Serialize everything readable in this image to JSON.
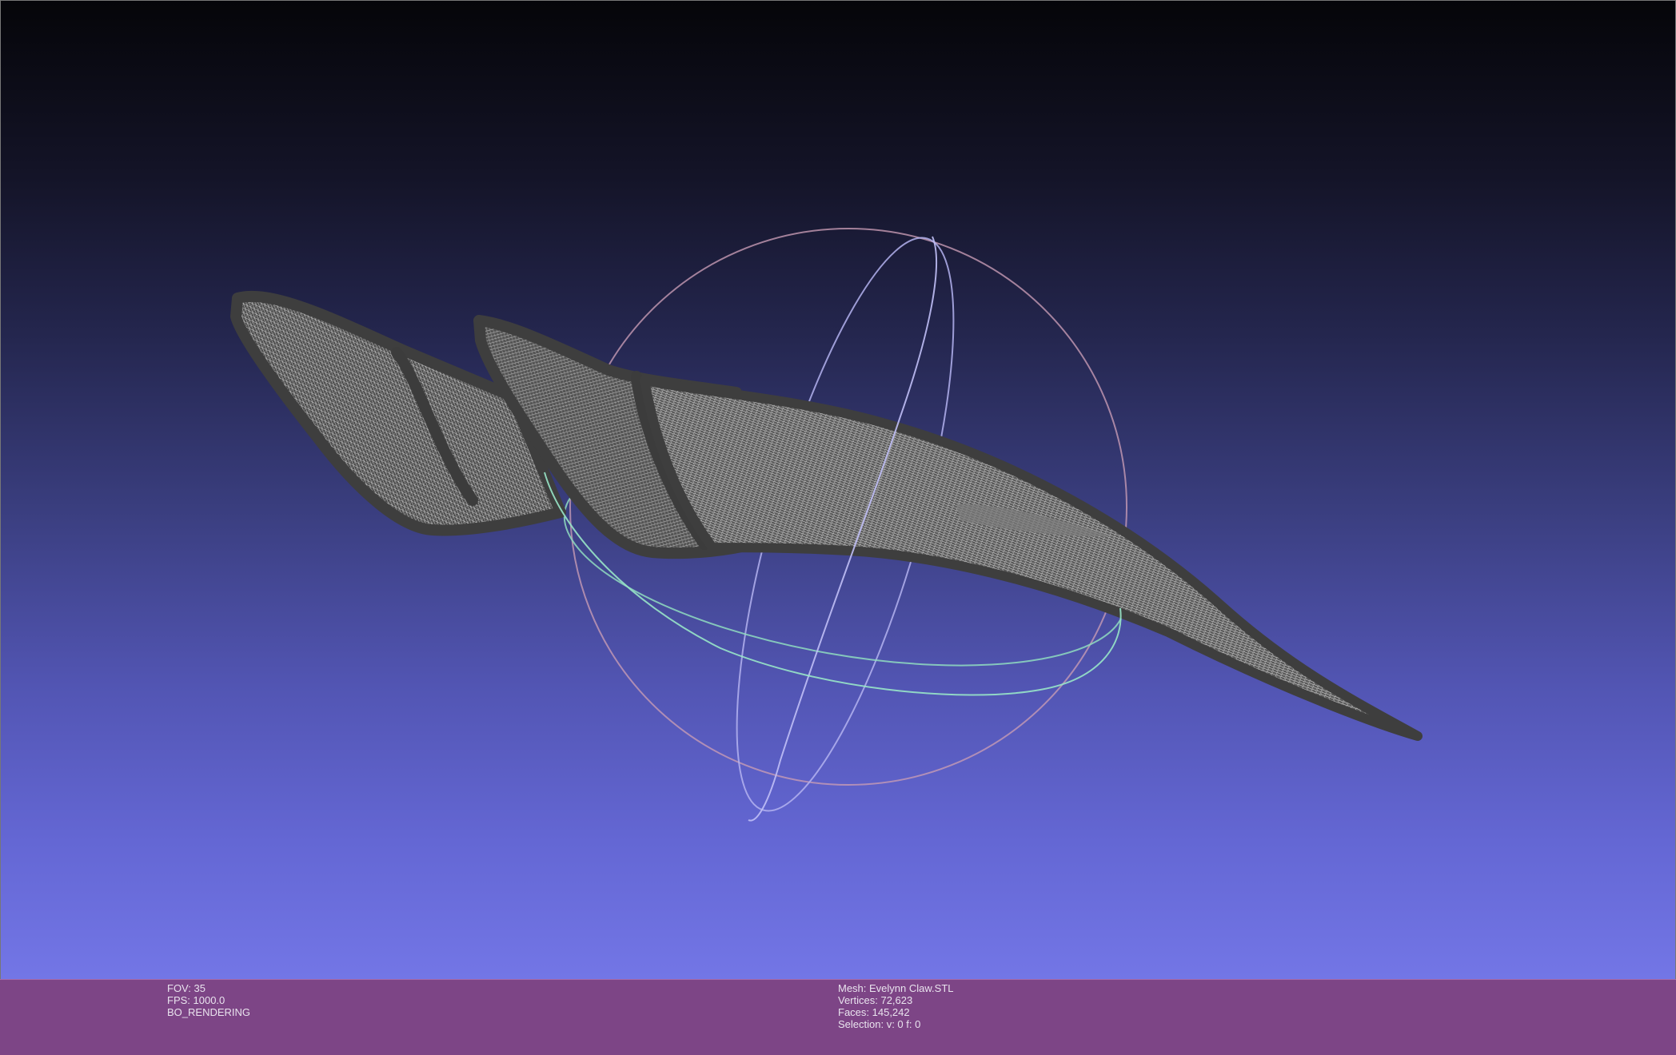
{
  "scene": {
    "background_top": "#050509",
    "background_bottom": "#7376e6",
    "mesh_color": "#4a4a4a",
    "wire_color": "#d8d8d8",
    "trackball": {
      "ring_red": "#d6a2b8",
      "ring_green": "#8fe0c0",
      "ring_blue": "#b6b4f2"
    }
  },
  "status": {
    "left": {
      "fov": "FOV: 35",
      "fps": "FPS:  1000.0",
      "mode": "BO_RENDERING"
    },
    "right": {
      "mesh": "Mesh: Evelynn Claw.STL",
      "vertices": "Vertices: 72,623",
      "faces": "Faces: 145,242",
      "selection": "Selection: v: 0 f: 0"
    }
  }
}
